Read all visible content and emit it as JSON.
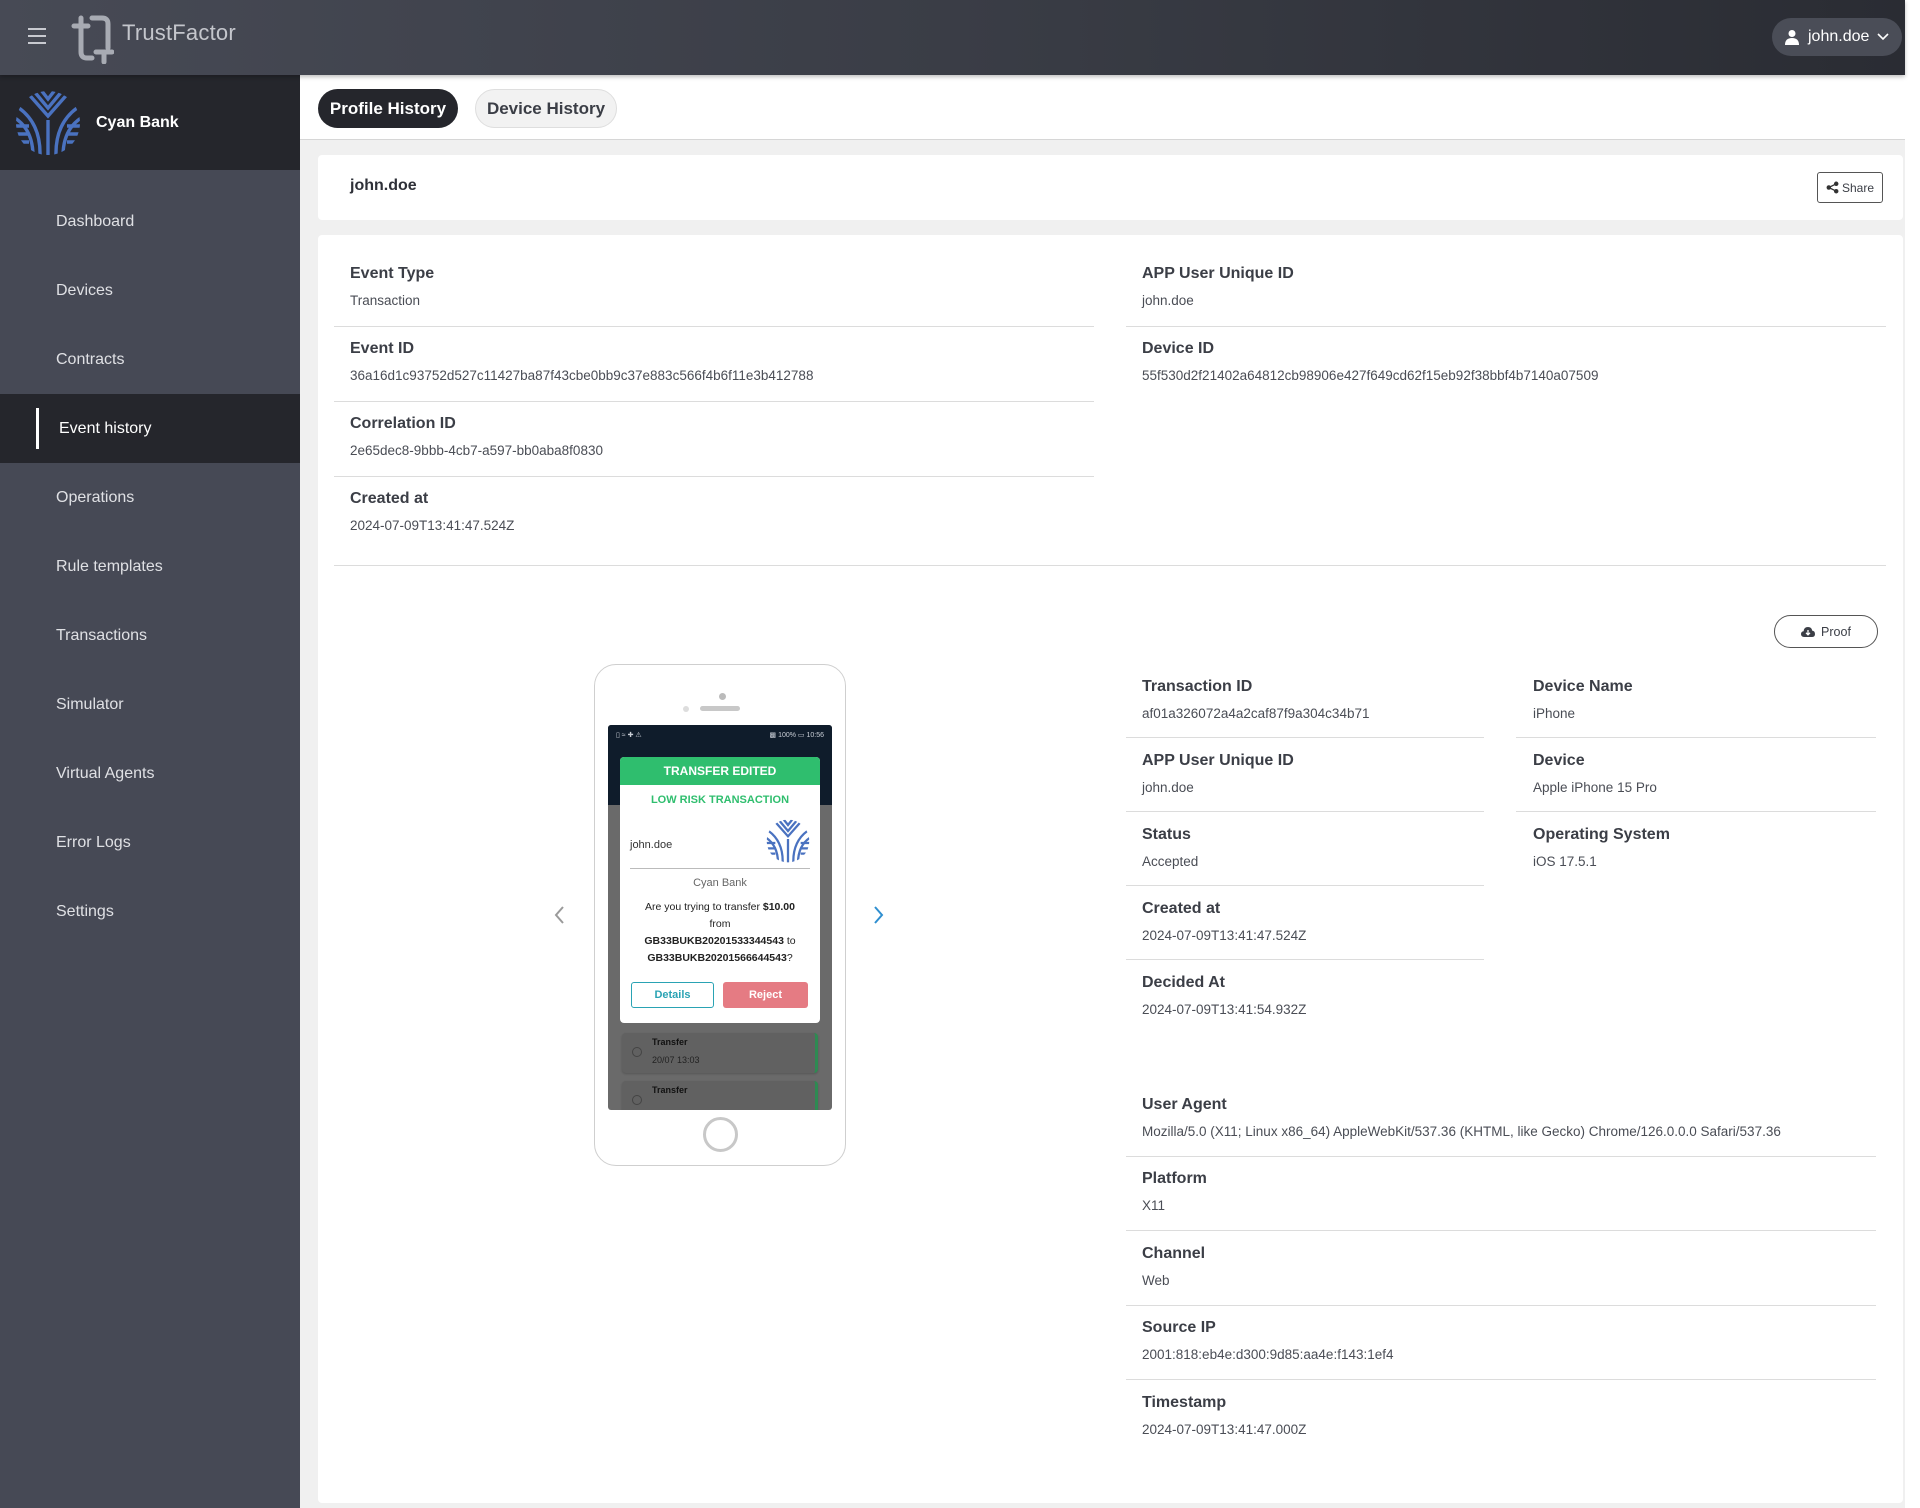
{
  "header": {
    "app_name": "TrustFactor",
    "user_menu_label": "john.doe"
  },
  "sidebar": {
    "brand_name": "Cyan Bank",
    "items": [
      {
        "label": "Dashboard",
        "active": false
      },
      {
        "label": "Devices",
        "active": false
      },
      {
        "label": "Contracts",
        "active": false
      },
      {
        "label": "Event history",
        "active": true
      },
      {
        "label": "Operations",
        "active": false
      },
      {
        "label": "Rule templates",
        "active": false
      },
      {
        "label": "Transactions",
        "active": false
      },
      {
        "label": "Simulator",
        "active": false
      },
      {
        "label": "Virtual Agents",
        "active": false
      },
      {
        "label": "Error Logs",
        "active": false
      },
      {
        "label": "Settings",
        "active": false
      }
    ]
  },
  "tabs": [
    {
      "label": "Profile History",
      "active": true
    },
    {
      "label": "Device History",
      "active": false
    }
  ],
  "user_card": {
    "username": "john.doe",
    "share_label": "Share"
  },
  "event": {
    "event_type": {
      "label": "Event Type",
      "value": "Transaction"
    },
    "event_id": {
      "label": "Event ID",
      "value": "36a16d1c93752d527c11427ba87f43cbe0bb9c37e883c566f4b6f11e3b412788"
    },
    "correlation_id": {
      "label": "Correlation ID",
      "value": "2e65dec8-9bbb-4cb7-a597-bb0aba8f0830"
    },
    "created_at": {
      "label": "Created at",
      "value": "2024-07-09T13:41:47.524Z"
    },
    "app_user_id": {
      "label": "APP User Unique ID",
      "value": "john.doe"
    },
    "device_id": {
      "label": "Device ID",
      "value": "55f530d2f21402a64812cb98906e427f649cd62f15eb92f38bbf4b7140a07509"
    }
  },
  "proof_label": "Proof",
  "phone_preview": {
    "status_left": "▯ ≈ ✚ ⚠",
    "status_right": "▩ 100% ▭ 10:56",
    "modal_title": "TRANSFER EDITED",
    "risk_label": "LOW RISK TRANSACTION",
    "username": "john.doe",
    "bank_name": "Cyan Bank",
    "message_prefix": "Are you trying to transfer",
    "amount": "$10.00",
    "from_word": "from",
    "from_account": "GB33BUKB20201533344543",
    "to_word": "to",
    "to_account": "GB33BUKB20201566644543",
    "question_mark": "?",
    "details_label": "Details",
    "reject_label": "Reject",
    "list_items": [
      {
        "title": "Transfer",
        "time": "20/07 13:03"
      },
      {
        "title": "Transfer",
        "time": ""
      }
    ]
  },
  "transaction": {
    "transaction_id": {
      "label": "Transaction ID",
      "value": "af01a326072a4a2caf87f9a304c34b71"
    },
    "app_user_id": {
      "label": "APP User Unique ID",
      "value": "john.doe"
    },
    "status": {
      "label": "Status",
      "value": "Accepted"
    },
    "created_at": {
      "label": "Created at",
      "value": "2024-07-09T13:41:47.524Z"
    },
    "decided_at": {
      "label": "Decided At",
      "value": "2024-07-09T13:41:54.932Z"
    },
    "device_name": {
      "label": "Device Name",
      "value": "iPhone"
    },
    "device": {
      "label": "Device",
      "value": "Apple iPhone 15 Pro"
    },
    "operating_system": {
      "label": "Operating System",
      "value": "iOS 17.5.1"
    },
    "user_agent": {
      "label": "User Agent",
      "value": "Mozilla/5.0 (X11; Linux x86_64) AppleWebKit/537.36 (KHTML, like Gecko) Chrome/126.0.0.0 Safari/537.36"
    },
    "platform": {
      "label": "Platform",
      "value": "X11"
    },
    "channel": {
      "label": "Channel",
      "value": "Web"
    },
    "source_ip": {
      "label": "Source IP",
      "value": "2001:818:eb4e:d300:9d85:aa4e:f143:1ef4"
    },
    "timestamp": {
      "label": "Timestamp",
      "value": "2024-07-09T13:41:47.000Z"
    }
  },
  "colors": {
    "accent_green": "#2fbe6e",
    "reject_red": "#e57b83",
    "details_teal": "#2aa3b4",
    "brand_blue": "#4a72c0",
    "nav_arrow_active": "#2f8fd0"
  }
}
